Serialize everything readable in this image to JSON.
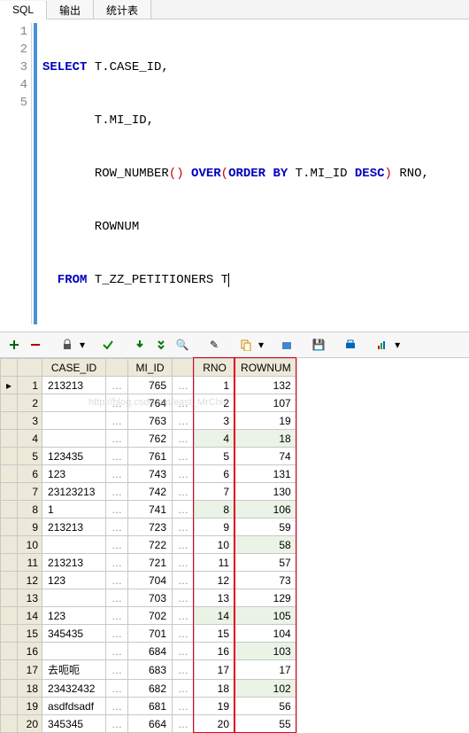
{
  "tabs": {
    "sql": "SQL",
    "output": "输出",
    "stats": "统计表"
  },
  "code": {
    "l1": {
      "kw1": "SELECT",
      "c": " T.CASE_ID,"
    },
    "l2": {
      "c": "       T.MI_ID,"
    },
    "l3": {
      "c1": "       ",
      "fn": "ROW_NUMBER",
      "p1": "()",
      "kw2": " OVER",
      "p2": "(",
      "kw3": "ORDER BY",
      "c2": " T.MI_ID ",
      "kw4": "DESC",
      "p3": ")",
      "c3": " RNO,"
    },
    "l4": {
      "c": "       ROWNUM"
    },
    "l5": {
      "kw1": "  FROM",
      "c": " T_ZZ_PETITIONERS T"
    }
  },
  "headers": {
    "case_id": "CASE_ID",
    "mi_id": "MI_ID",
    "rno": "RNO",
    "rownum": "ROWNUM"
  },
  "rows": [
    {
      "n": 1,
      "case_id": "213213",
      "mi_id": 765,
      "rno": 1,
      "rownum": 132
    },
    {
      "n": 2,
      "case_id": "",
      "mi_id": 764,
      "rno": 2,
      "rownum": 107
    },
    {
      "n": 3,
      "case_id": "",
      "mi_id": 763,
      "rno": 3,
      "rownum": 19
    },
    {
      "n": 4,
      "case_id": "",
      "mi_id": 762,
      "rno": 4,
      "rownum": 18
    },
    {
      "n": 5,
      "case_id": "123435",
      "mi_id": 761,
      "rno": 5,
      "rownum": 74
    },
    {
      "n": 6,
      "case_id": "123",
      "mi_id": 743,
      "rno": 6,
      "rownum": 131
    },
    {
      "n": 7,
      "case_id": "23123213",
      "mi_id": 742,
      "rno": 7,
      "rownum": 130
    },
    {
      "n": 8,
      "case_id": "1",
      "mi_id": 741,
      "rno": 8,
      "rownum": 106
    },
    {
      "n": 9,
      "case_id": "213213",
      "mi_id": 723,
      "rno": 9,
      "rownum": 59
    },
    {
      "n": 10,
      "case_id": "",
      "mi_id": 722,
      "rno": 10,
      "rownum": 58
    },
    {
      "n": 11,
      "case_id": "213213",
      "mi_id": 721,
      "rno": 11,
      "rownum": 57
    },
    {
      "n": 12,
      "case_id": "123",
      "mi_id": 704,
      "rno": 12,
      "rownum": 73
    },
    {
      "n": 13,
      "case_id": "",
      "mi_id": 703,
      "rno": 13,
      "rownum": 129
    },
    {
      "n": 14,
      "case_id": "123",
      "mi_id": 702,
      "rno": 14,
      "rownum": 105
    },
    {
      "n": 15,
      "case_id": "345435",
      "mi_id": 701,
      "rno": 15,
      "rownum": 104
    },
    {
      "n": 16,
      "case_id": "",
      "mi_id": 684,
      "rno": 16,
      "rownum": 103
    },
    {
      "n": 17,
      "case_id": "去呃呃",
      "mi_id": 683,
      "rno": 17,
      "rownum": 17
    },
    {
      "n": 18,
      "case_id": "23432432",
      "mi_id": 682,
      "rno": 18,
      "rownum": 102
    },
    {
      "n": 19,
      "case_id": "asdfdsadf",
      "mi_id": 681,
      "rno": 19,
      "rownum": 56
    },
    {
      "n": 20,
      "case_id": "345345",
      "mi_id": 664,
      "rno": 20,
      "rownum": 55
    }
  ],
  "watermark": "http://blog.csdn.net/east_MrChiu",
  "highlights": {
    "rno_selected_rows": [
      4,
      8,
      14
    ],
    "rownum_selected_rows": [
      4,
      8,
      10,
      14,
      16,
      18
    ]
  }
}
